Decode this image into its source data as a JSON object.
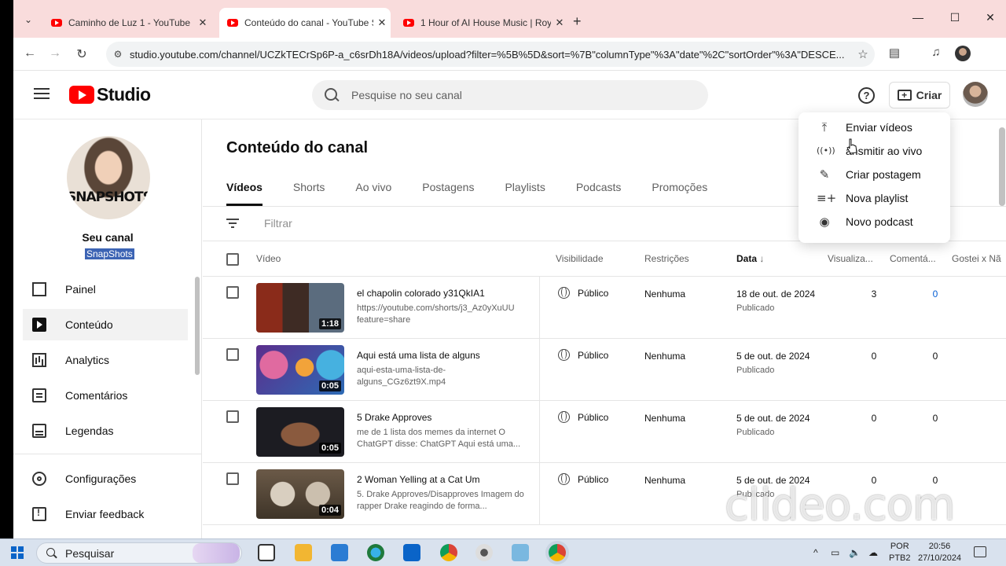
{
  "browser": {
    "tabs": [
      {
        "title": "Caminho de Luz 1 - YouTube",
        "active": false
      },
      {
        "title": "Conteúdo do canal - YouTube S",
        "active": true
      },
      {
        "title": "1 Hour of AI House Music | Roy",
        "active": false
      }
    ],
    "url": "studio.youtube.com/channel/UCZkTECrSp6P-a_c6srDh18A/videos/upload?filter=%5B%5D&sort=%7B\"columnType\"%3A\"date\"%2C\"sortOrder\"%3A\"DESCE..."
  },
  "header": {
    "logo_text": "Studio",
    "search_placeholder": "Pesquise no seu canal",
    "create_label": "Criar"
  },
  "sidebar": {
    "channel_initials": "SNAPSHOTS",
    "channel_title": "Seu canal",
    "channel_name": "SnapShots",
    "items": [
      {
        "label": "Painel",
        "icon": "dashboard-icon",
        "active": false
      },
      {
        "label": "Conteúdo",
        "icon": "content-icon",
        "active": true
      },
      {
        "label": "Analytics",
        "icon": "analytics-icon",
        "active": false
      },
      {
        "label": "Comentários",
        "icon": "comments-icon",
        "active": false
      },
      {
        "label": "Legendas",
        "icon": "subtitles-icon",
        "active": false
      },
      {
        "label": "Configurações",
        "icon": "settings-icon",
        "active": false
      },
      {
        "label": "Enviar feedback",
        "icon": "feedback-icon",
        "active": false
      }
    ]
  },
  "main": {
    "title": "Conteúdo do canal",
    "tabs": [
      "Vídeos",
      "Shorts",
      "Ao vivo",
      "Postagens",
      "Playlists",
      "Podcasts",
      "Promoções"
    ],
    "filter_placeholder": "Filtrar",
    "columns": {
      "video": "Vídeo",
      "visibility": "Visibilidade",
      "restrictions": "Restrições",
      "date": "Data",
      "views": "Visualiza...",
      "comments": "Comentá...",
      "likes": "Gostei x Nã"
    },
    "rows": [
      {
        "title": "el chapolin colorado y31QkIA1",
        "desc": "https://youtube.com/shorts/j3_Az0yXuUU feature=share",
        "duration": "1:18",
        "visibility": "Público",
        "restrictions": "Nenhuma",
        "date": "18 de out. de 2024",
        "status": "Publicado",
        "views": "3",
        "comments": "0"
      },
      {
        "title": "Aqui está uma lista de alguns",
        "desc": "aqui-esta-uma-lista-de-alguns_CGz6zt9X.mp4",
        "duration": "0:05",
        "visibility": "Público",
        "restrictions": "Nenhuma",
        "date": "5 de out. de 2024",
        "status": "Publicado",
        "views": "0",
        "comments": "0"
      },
      {
        "title": "5 Drake Approves",
        "desc": "me de 1 lista dos memes da internet O ChatGPT disse: ChatGPT Aqui está uma...",
        "duration": "0:05",
        "visibility": "Público",
        "restrictions": "Nenhuma",
        "date": "5 de out. de 2024",
        "status": "Publicado",
        "views": "0",
        "comments": "0"
      },
      {
        "title": "2 Woman Yelling at a Cat Um",
        "desc": "5. Drake Approves/Disapproves Imagem do rapper Drake reagindo de forma...",
        "duration": "0:04",
        "visibility": "Público",
        "restrictions": "Nenhuma",
        "date": "5 de out. de 2024",
        "status": "Publicado",
        "views": "0",
        "comments": "0"
      }
    ]
  },
  "create_menu": {
    "items": [
      {
        "label": "Enviar vídeos",
        "icon": "upload-icon"
      },
      {
        "label": "ansmitir ao vivo",
        "icon": "live-icon"
      },
      {
        "label": "Criar postagem",
        "icon": "edit-post-icon"
      },
      {
        "label": "Nova playlist",
        "icon": "playlist-add-icon"
      },
      {
        "label": "Novo podcast",
        "icon": "podcast-icon"
      }
    ]
  },
  "watermark": "clideo.com",
  "taskbar": {
    "search_label": "Pesquisar",
    "lang": [
      "POR",
      "PTB2"
    ],
    "time": "20:56",
    "date": "27/10/2024"
  }
}
